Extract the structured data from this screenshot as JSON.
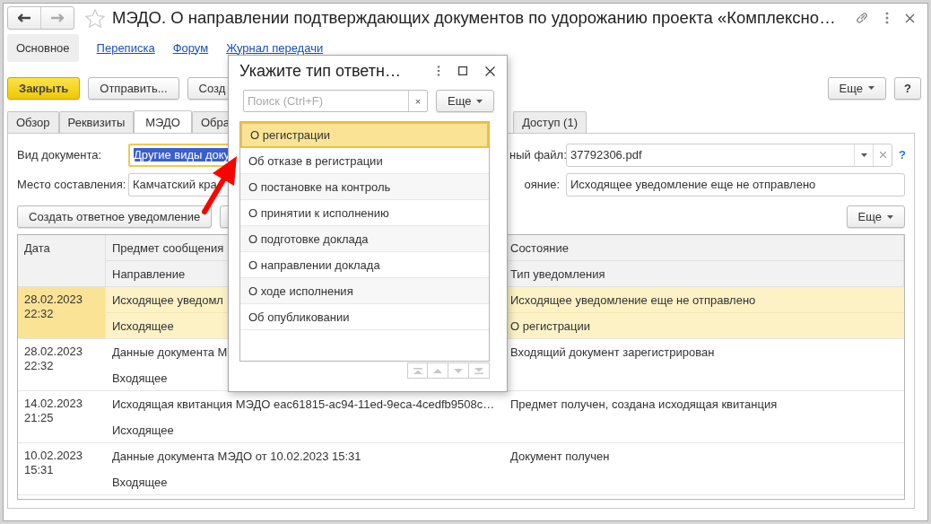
{
  "window": {
    "title": "МЭДО. О направлении подтверждающих документов по удорожанию проекта «Комплексно…"
  },
  "nav": [
    {
      "label": "Основное",
      "selected": true
    },
    {
      "label": "Переписка",
      "selected": false
    },
    {
      "label": "Форум",
      "selected": false
    },
    {
      "label": "Журнал передачи",
      "selected": false
    }
  ],
  "toolbar": {
    "buttons": [
      {
        "label": "Закрыть",
        "kind": "primary"
      },
      {
        "label": "Отправить...",
        "kind": "normal"
      },
      {
        "label": "Созд",
        "kind": "normal"
      }
    ],
    "more": "Еще",
    "help": "?"
  },
  "tabs": [
    {
      "label": "Обзор",
      "selected": false
    },
    {
      "label": "Реквизиты",
      "selected": false
    },
    {
      "label": "МЭДО",
      "selected": true
    },
    {
      "label": "Обра",
      "selected": false
    },
    {
      "label": "Доступ (1)",
      "selected": false
    }
  ],
  "left_fields": [
    {
      "label": "Вид документа:",
      "value": "Другие виды доку",
      "focused": true
    },
    {
      "label": "Место составления:",
      "value": "Камчатский кра",
      "focused": false
    }
  ],
  "right_fields": [
    {
      "label": "ный файл:",
      "value": "37792306.pdf",
      "kind": "select",
      "help": "?"
    },
    {
      "label": "ояние:",
      "value": "Исходящее уведомление еще не отправлено",
      "kind": "text"
    }
  ],
  "actions": {
    "create": "Создать ответное уведомление",
    "more": "Еще"
  },
  "table": {
    "columns": {
      "date": "Дата",
      "subject": "Предмет сообщения",
      "direction": "Направление",
      "status": "Состояние",
      "type": "Тип уведомления"
    },
    "rows": [
      {
        "date": "28.02.2023",
        "time": "22:32",
        "subject": "Исходящее уведомл",
        "direction": "Исходящее",
        "status": "Исходящее уведомление еще не отправлено",
        "type": "О регистрации",
        "selected": true
      },
      {
        "date": "28.02.2023",
        "time": "22:32",
        "subject": "Данные документа М",
        "direction": "Входящее",
        "status": "Входящий документ зарегистрирован",
        "selected": false
      },
      {
        "date": "14.02.2023",
        "time": "21:25",
        "subject": "Исходящая квитанция МЭДО eac61815-ac94-11ed-9eca-4cedfb9508c…",
        "direction": "Исходящее",
        "status": "Предмет получен, создана исходящая квитанция",
        "selected": false
      },
      {
        "date": "10.02.2023",
        "time": "15:31",
        "subject": "Данные документа МЭДО от 10.02.2023 15:31",
        "direction": "Входящее",
        "status": "Документ получен",
        "selected": false
      }
    ]
  },
  "dialog": {
    "title": "Укажите тип ответн…",
    "search": {
      "placeholder": "Поиск (Ctrl+F)",
      "clear": "×"
    },
    "more": "Еще",
    "items": [
      {
        "label": "О регистрации",
        "selected": true
      },
      {
        "label": "Об отказе в регистрации",
        "selected": false
      },
      {
        "label": "О постановке на контроль",
        "selected": false
      },
      {
        "label": "О принятии к исполнению",
        "selected": false
      },
      {
        "label": "О подготовке доклада",
        "selected": false
      },
      {
        "label": "О направлении доклада",
        "selected": false
      },
      {
        "label": "О ходе исполнения",
        "selected": false
      },
      {
        "label": "Об опубликовании",
        "selected": false
      }
    ]
  }
}
